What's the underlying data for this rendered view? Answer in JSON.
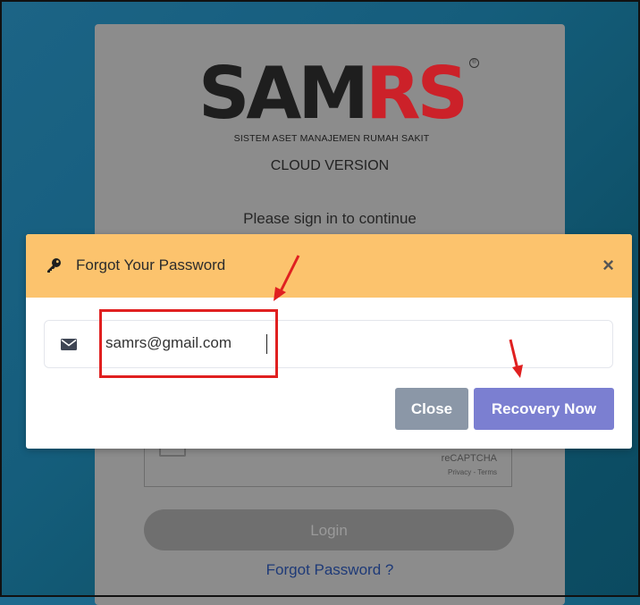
{
  "login": {
    "logo_main": "SAM",
    "logo_accent": "RS",
    "registered_mark": "®",
    "tagline": "SISTEM ASET MANAJEMEN RUMAH SAKIT",
    "subtitle": "CLOUD VERSION",
    "signin_hint": "Please sign in to continue",
    "recaptcha_label": "reCAPTCHA",
    "recaptcha_links": "Privacy - Terms",
    "login_button": "Login",
    "forgot_link": "Forgot Password ?"
  },
  "modal": {
    "title": "Forgot Your Password",
    "title_icon": "key-icon",
    "close_symbol": "×",
    "email_icon": "envelope-icon",
    "email_value": "samrs@gmail.com",
    "close_button": "Close",
    "recovery_button": "Recovery Now"
  },
  "colors": {
    "modal_header": "#fcc36d",
    "recovery_button": "#7b7fd1",
    "close_button": "#8b97a7",
    "annotation_red": "#e02020",
    "logo_red": "#cc2129"
  }
}
